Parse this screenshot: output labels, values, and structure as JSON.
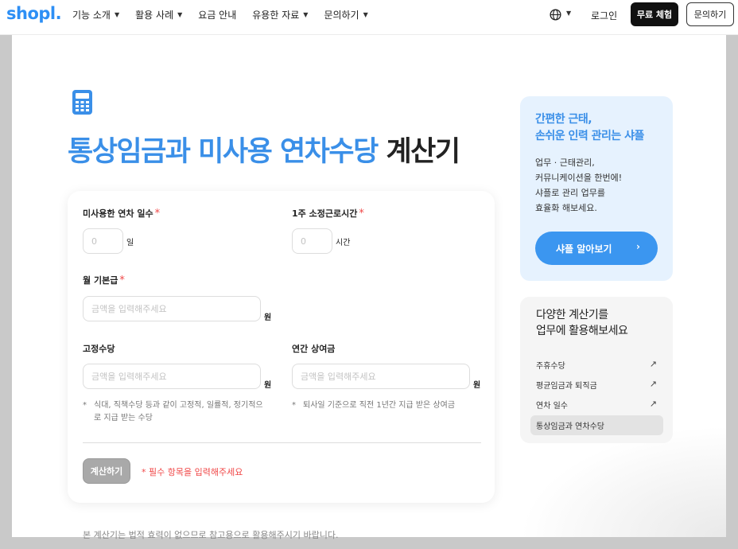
{
  "nav": {
    "logo": "shopl.",
    "menu": [
      {
        "label": "기능 소개",
        "has_dropdown": true
      },
      {
        "label": "활용 사례",
        "has_dropdown": true
      },
      {
        "label": "요금 안내",
        "has_dropdown": false
      },
      {
        "label": "유용한 자료",
        "has_dropdown": true
      },
      {
        "label": "문의하기",
        "has_dropdown": true
      }
    ],
    "caret": "▼",
    "language_icon": "globe-icon",
    "login": "로그인",
    "free_trial": "무료 체험",
    "inquiry": "문의하기"
  },
  "title": {
    "highlight": "통상임금과 미사용 연차수당",
    "rest": "계산기",
    "icon": "calculator-icon",
    "accent_color": "#3a8fe8"
  },
  "form": {
    "unused_days": {
      "label": "미사용한 연차 일수",
      "required_mark": "*",
      "placeholder": "0",
      "unit": "일"
    },
    "weekly_hours": {
      "label": "1주 소정근로시간",
      "required_mark": "*",
      "placeholder": "0",
      "unit": "시간"
    },
    "monthly_salary": {
      "label": "월 기본급",
      "required_mark": "*",
      "placeholder": "금액을 입력해주세요",
      "unit": "원"
    },
    "fixed_allowance": {
      "label": "고정수당",
      "placeholder": "금액을 입력해주세요",
      "unit": "원",
      "note_mark": "*",
      "note": "식대, 직책수당 등과 같이 고정적, 일률적, 정기적으\n로 지급 받는 수당"
    },
    "annual_bonus": {
      "label": "연간 상여금",
      "placeholder": "금액을 입력해주세요",
      "unit": "원",
      "note_mark": "*",
      "note": "퇴사일 기준으로 직전 1년간 지급 받은 상여금"
    },
    "calc_button": "계산하기",
    "required_message": "* 필수 항목을 입력해주세요"
  },
  "disclaimer": "본 계산기는 법적 효력이 없으므로 참고용으로 활용해주시기 바랍니다.",
  "promo": {
    "title": "간편한 근태,\n손쉬운 인력 관리는 샤플",
    "body": "업무 · 근태관리,\n커뮤니케이션을 한번에!\n샤플로 관리 업무를\n효율화 해보세요.",
    "button": "샤플 알아보기",
    "button_arrow": "›"
  },
  "calculators": {
    "title": "다양한 계산기를\n업무에 활용해보세요",
    "items": [
      {
        "label": "주휴수당",
        "icon": "↗"
      },
      {
        "label": "평균임금과 퇴직금",
        "icon": "↗"
      },
      {
        "label": "연차 일수",
        "icon": "↗"
      },
      {
        "label": "통상임금과 연차수당",
        "icon": ""
      }
    ]
  }
}
